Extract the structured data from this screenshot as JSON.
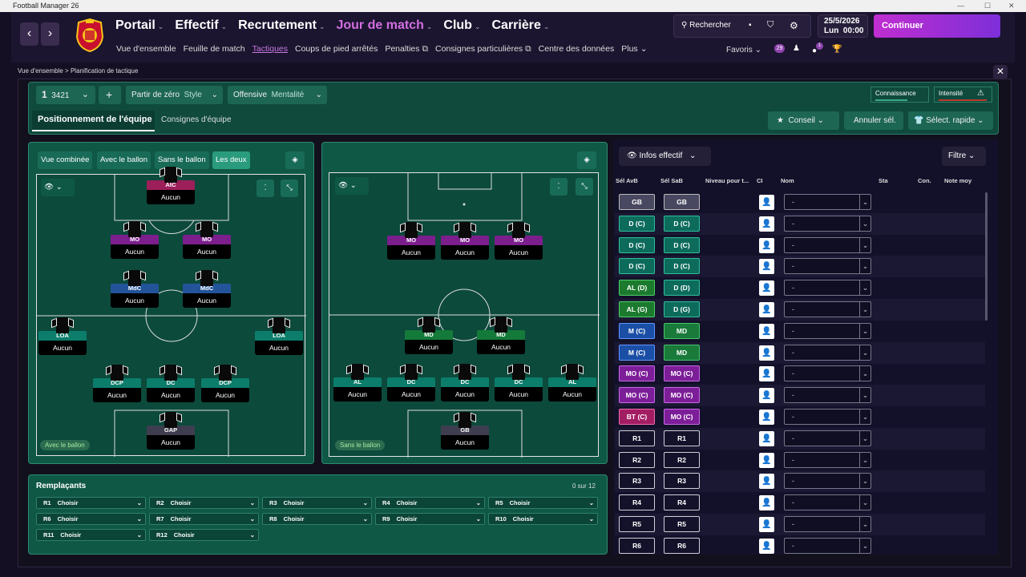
{
  "window": {
    "title": "Football Manager 26"
  },
  "nav": {
    "menu": [
      {
        "label": "Portail"
      },
      {
        "label": "Effectif"
      },
      {
        "label": "Recrutement"
      },
      {
        "label": "Jour de match"
      },
      {
        "label": "Club"
      },
      {
        "label": "Carrière"
      }
    ],
    "submenu": [
      "Vue d'ensemble",
      "Feuille de match",
      "Tactiques",
      "Coups de pied arrêtés",
      "Penalties",
      "Consignes particulières",
      "Centre des données",
      "Plus"
    ],
    "search_label": "Rechercher",
    "date": "25/5/2026",
    "time": "Lun  00:00",
    "continue": "Continuer",
    "favorites": "Favoris",
    "badge1": "29",
    "badge2": "1"
  },
  "breadcrumb": {
    "root": "Vue d'ensemble",
    "current": "Planification de tactique"
  },
  "tactic": {
    "slot": "1",
    "formation": "3421",
    "style_label": "Partir de zéro",
    "style_hint": "Style",
    "mentality_label": "Offensive",
    "mentality_hint": "Mentalité",
    "knowledge": "Connaissance",
    "intensity": "Intensité",
    "tabs": [
      "Positionnement de l'équipe",
      "Consignes d'équipe"
    ],
    "advice": "Conseil",
    "undo": "Annuler sél.",
    "quick": "Sélect. rapide"
  },
  "pitch_left": {
    "views": [
      "Vue combinée",
      "Avec le ballon",
      "Sans le ballon",
      "Les deux"
    ],
    "caption": "Avec le ballon",
    "players": [
      {
        "role": "AtC",
        "duty": "Aucun",
        "cls": "r-at"
      },
      {
        "role": "MO",
        "duty": "Aucun",
        "cls": "r-mo"
      },
      {
        "role": "MO",
        "duty": "Aucun",
        "cls": "r-mo"
      },
      {
        "role": "MdC",
        "duty": "Aucun",
        "cls": "r-mdc"
      },
      {
        "role": "MdC",
        "duty": "Aucun",
        "cls": "r-mdc"
      },
      {
        "role": "LOA",
        "duty": "Aucun",
        "cls": "r-def"
      },
      {
        "role": "LOA",
        "duty": "Aucun",
        "cls": "r-def"
      },
      {
        "role": "DCP",
        "duty": "Aucun",
        "cls": "r-def"
      },
      {
        "role": "DC",
        "duty": "Aucun",
        "cls": "r-def"
      },
      {
        "role": "DCP",
        "duty": "Aucun",
        "cls": "r-def"
      },
      {
        "role": "GAP",
        "duty": "Aucun",
        "cls": "r-gk"
      }
    ]
  },
  "pitch_right": {
    "caption": "Sans le ballon",
    "players": [
      {
        "role": "MO",
        "duty": "Aucun",
        "cls": "r-mo"
      },
      {
        "role": "MO",
        "duty": "Aucun",
        "cls": "r-mo"
      },
      {
        "role": "MO",
        "duty": "Aucun",
        "cls": "r-mo"
      },
      {
        "role": "MD",
        "duty": "Aucun",
        "cls": "r-md"
      },
      {
        "role": "MD",
        "duty": "Aucun",
        "cls": "r-md"
      },
      {
        "role": "AL",
        "duty": "Aucun",
        "cls": "r-def"
      },
      {
        "role": "DC",
        "duty": "Aucun",
        "cls": "r-def"
      },
      {
        "role": "DC",
        "duty": "Aucun",
        "cls": "r-def"
      },
      {
        "role": "DC",
        "duty": "Aucun",
        "cls": "r-def"
      },
      {
        "role": "AL",
        "duty": "Aucun",
        "cls": "r-def"
      },
      {
        "role": "GB",
        "duty": "Aucun",
        "cls": "r-gk"
      }
    ]
  },
  "subs": {
    "title": "Remplaçants",
    "count": "0 sur 12",
    "slots": [
      {
        "id": "R1",
        "val": "Choisir"
      },
      {
        "id": "R2",
        "val": "Choisir"
      },
      {
        "id": "R3",
        "val": "Choisir"
      },
      {
        "id": "R4",
        "val": "Choisir"
      },
      {
        "id": "R5",
        "val": "Choisir"
      },
      {
        "id": "R6",
        "val": "Choisir"
      },
      {
        "id": "R7",
        "val": "Choisir"
      },
      {
        "id": "R8",
        "val": "Choisir"
      },
      {
        "id": "R9",
        "val": "Choisir"
      },
      {
        "id": "R10",
        "val": "Choisir"
      },
      {
        "id": "R11",
        "val": "Choisir"
      },
      {
        "id": "R12",
        "val": "Choisir"
      }
    ]
  },
  "selection": {
    "view_label": "Infos effectif",
    "filter": "Filtre",
    "columns": [
      "Sél AvB",
      "Sél SaB",
      "Niveau pour t...",
      "CI",
      "Nom",
      "Sta",
      "Con.",
      "Note moy"
    ],
    "rows": [
      {
        "a": "GB",
        "ac": "c-gk",
        "b": "GB",
        "bc": "c-gk",
        "name": "-"
      },
      {
        "a": "D (C)",
        "ac": "c-d",
        "b": "D (C)",
        "bc": "c-d",
        "name": "-"
      },
      {
        "a": "D (C)",
        "ac": "c-d",
        "b": "D (C)",
        "bc": "c-d",
        "name": "-"
      },
      {
        "a": "D (C)",
        "ac": "c-d",
        "b": "D (C)",
        "bc": "c-d",
        "name": "-"
      },
      {
        "a": "AL (D)",
        "ac": "c-al",
        "b": "D (D)",
        "bc": "c-d",
        "name": "-"
      },
      {
        "a": "AL (G)",
        "ac": "c-al",
        "b": "D (G)",
        "bc": "c-d",
        "name": "-"
      },
      {
        "a": "M (C)",
        "ac": "c-m",
        "b": "MD",
        "bc": "c-md",
        "name": "-"
      },
      {
        "a": "M (C)",
        "ac": "c-m",
        "b": "MD",
        "bc": "c-md",
        "name": "-"
      },
      {
        "a": "MO (C)",
        "ac": "c-mo",
        "b": "MO (C)",
        "bc": "c-mo",
        "name": "-"
      },
      {
        "a": "MO (C)",
        "ac": "c-mo",
        "b": "MO (C)",
        "bc": "c-mo",
        "name": "-"
      },
      {
        "a": "BT (C)",
        "ac": "c-bt",
        "b": "MO (C)",
        "bc": "c-mo",
        "name": "-"
      },
      {
        "a": "R1",
        "ac": "c-r",
        "b": "R1",
        "bc": "c-r",
        "name": "-"
      },
      {
        "a": "R2",
        "ac": "c-r",
        "b": "R2",
        "bc": "c-r",
        "name": "-"
      },
      {
        "a": "R3",
        "ac": "c-r",
        "b": "R3",
        "bc": "c-r",
        "name": "-"
      },
      {
        "a": "R4",
        "ac": "c-r",
        "b": "R4",
        "bc": "c-r",
        "name": "-"
      },
      {
        "a": "R5",
        "ac": "c-r",
        "b": "R5",
        "bc": "c-r",
        "name": "-"
      },
      {
        "a": "R6",
        "ac": "c-r",
        "b": "R6",
        "bc": "c-r",
        "name": "-"
      }
    ]
  }
}
